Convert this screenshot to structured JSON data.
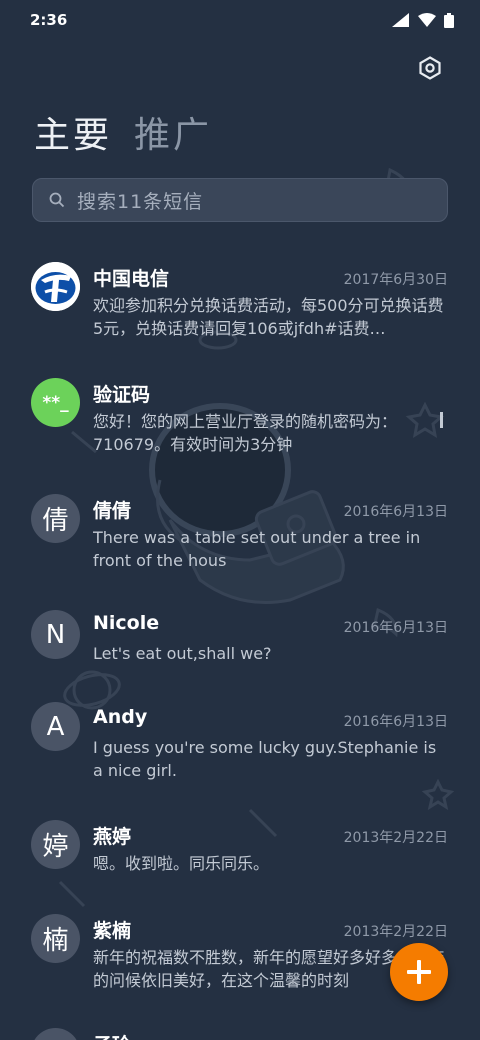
{
  "status_bar": {
    "time": "2:36"
  },
  "tabs": [
    {
      "label": "主要",
      "active": true
    },
    {
      "label": "推广",
      "active": false
    }
  ],
  "search": {
    "placeholder": "搜索11条短信"
  },
  "conversations": [
    {
      "name": "中国电信",
      "date": "2017年6月30日",
      "preview": "欢迎参加积分兑换话费活动，每500分可兑换话费5元，兑换话费请回复106或jfdh#话费…",
      "avatar": "",
      "avatar_icon": "china-telecom-logo-icon"
    },
    {
      "name": "验证码",
      "date": "",
      "preview": "您好！您的网上营业厅登录的随机密码为：710679。有效时间为3分钟",
      "avatar": "**_",
      "avatar_color": "#6cd25a"
    },
    {
      "name": "倩倩",
      "date": "2016年6月13日",
      "preview": "There was a table set out under a tree in front of the hous",
      "avatar": "倩"
    },
    {
      "name": "Nicole",
      "date": "2016年6月13日",
      "preview": "Let's eat out,shall we?",
      "avatar": "N"
    },
    {
      "name": "Andy",
      "date": "2016年6月13日",
      "preview": "I guess you're some lucky guy.Stephanie is a nice girl.",
      "avatar": "A"
    },
    {
      "name": "燕婷",
      "date": "2013年2月22日",
      "preview": "嗯。收到啦。同乐同乐。",
      "avatar": "婷"
    },
    {
      "name": "紫楠",
      "date": "2013年2月22日",
      "preview": "新年的祝福数不胜数，新年的愿望好多好多，新年的问候依旧美好，在这个温馨的时刻",
      "avatar": "楠"
    },
    {
      "name": "子玲",
      "date": "",
      "preview": "",
      "avatar": ""
    }
  ],
  "fab": {
    "icon": "plus-icon",
    "color": "#f57c00"
  },
  "colors": {
    "background": "#243042",
    "accent": "#f57c00"
  }
}
